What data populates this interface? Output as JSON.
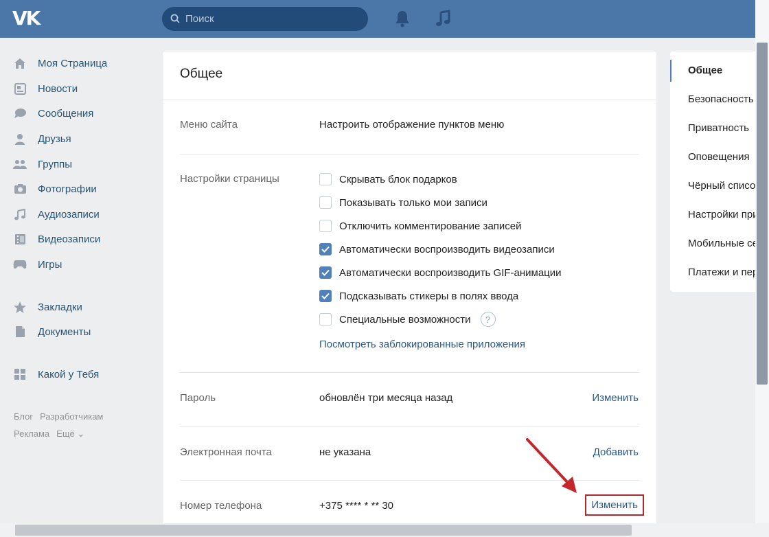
{
  "header": {
    "logo": "VK",
    "search_placeholder": "Поиск"
  },
  "nav": {
    "items": [
      {
        "label": "Моя Страница",
        "icon": "home-icon"
      },
      {
        "label": "Новости",
        "icon": "news-icon"
      },
      {
        "label": "Сообщения",
        "icon": "messages-icon"
      },
      {
        "label": "Друзья",
        "icon": "friends-icon"
      },
      {
        "label": "Группы",
        "icon": "groups-icon"
      },
      {
        "label": "Фотографии",
        "icon": "camera-icon"
      },
      {
        "label": "Аудиозаписи",
        "icon": "music-icon"
      },
      {
        "label": "Видеозаписи",
        "icon": "video-icon"
      },
      {
        "label": "Игры",
        "icon": "gamepad-icon"
      },
      {
        "label": "Закладки",
        "icon": "star-icon"
      },
      {
        "label": "Документы",
        "icon": "document-icon"
      },
      {
        "label": "Какой у Тебя",
        "icon": "app-grid-icon"
      }
    ],
    "footer": [
      "Блог",
      "Разработчикам",
      "Реклама",
      "Ещё ⌄"
    ]
  },
  "main": {
    "title": "Общее",
    "menu": {
      "label": "Меню сайта",
      "link": "Настроить отображение пунктов меню"
    },
    "page_settings": {
      "label": "Настройки страницы",
      "options": [
        {
          "text": "Скрывать блок подарков",
          "checked": false
        },
        {
          "text": "Показывать только мои записи",
          "checked": false
        },
        {
          "text": "Отключить комментирование записей",
          "checked": false
        },
        {
          "text": "Автоматически воспроизводить видеозаписи",
          "checked": true
        },
        {
          "text": "Автоматически воспроизводить GIF-анимации",
          "checked": true
        },
        {
          "text": "Подсказывать стикеры в полях ввода",
          "checked": true
        },
        {
          "text": "Специальные возможности",
          "checked": false
        }
      ],
      "help": "?",
      "blocked_link": "Посмотреть заблокированные приложения"
    },
    "password": {
      "label": "Пароль",
      "value": "обновлён три месяца назад",
      "action": "Изменить"
    },
    "email": {
      "label": "Электронная почта",
      "value": "не указана",
      "action": "Добавить"
    },
    "phone": {
      "label": "Номер телефона",
      "value": "+375 **** * ** 30",
      "action": "Изменить"
    }
  },
  "right_menu": {
    "items": [
      "Общее",
      "Безопасность",
      "Приватность",
      "Оповещения",
      "Чёрный список",
      "Настройки приложений",
      "Мобильные сервисы",
      "Платежи и переводы"
    ]
  },
  "colors": {
    "header": "#4a76a8",
    "link": "#2a5885",
    "checkbox": "#5181b8",
    "highlight": "#b3262b"
  }
}
